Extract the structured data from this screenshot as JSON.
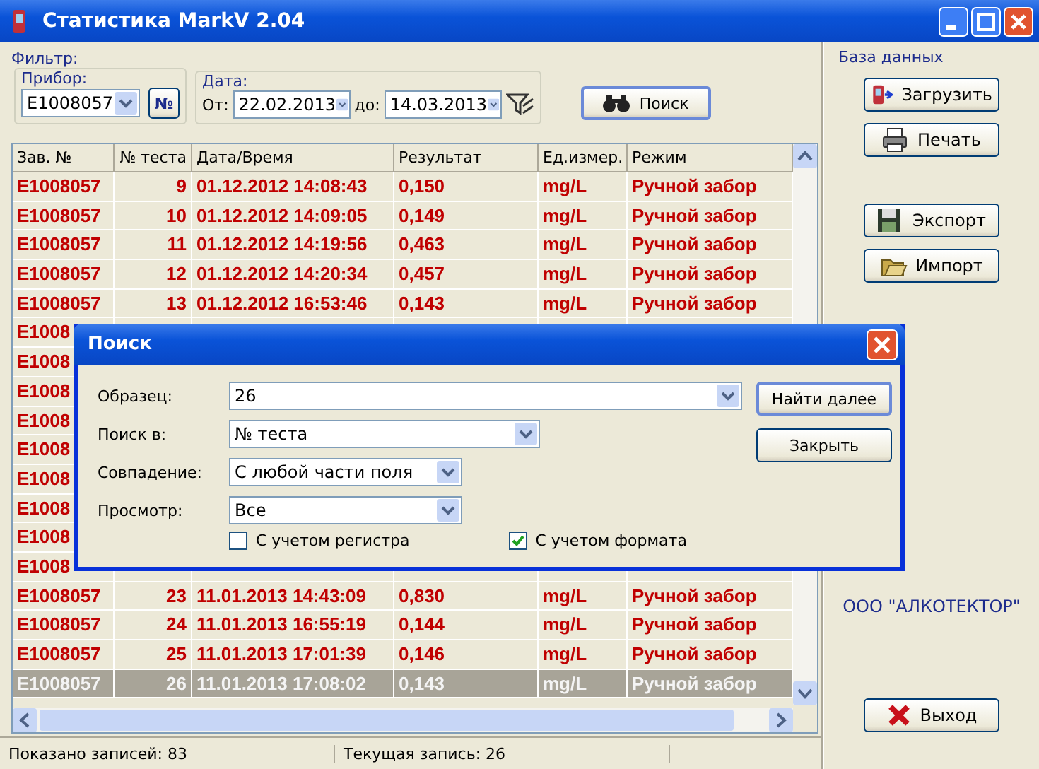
{
  "window": {
    "title": "Статистика MarkV 2.04"
  },
  "filter": {
    "title": "Фильтр:",
    "device_label": "Прибор:",
    "device": "E1008057",
    "number_button": "№",
    "date_label": "Дата:",
    "from_label": "От:",
    "from": "22.02.2013",
    "to_label": "до:",
    "to": "14.03.2013",
    "search_button": "Поиск"
  },
  "database": {
    "title": "База данных",
    "buttons": [
      {
        "label": "Загрузить",
        "kind": "load"
      },
      {
        "label": "Печать",
        "kind": "print"
      },
      {
        "label": "Экспорт",
        "kind": "export"
      },
      {
        "label": "Импорт",
        "kind": "import"
      }
    ],
    "company": "ООО \"АЛКОТЕКТОР\"",
    "exit_button": "Выход"
  },
  "table": {
    "columns": [
      "Зав. №",
      "№ теста",
      "Дата/Время",
      "Результат",
      "Ед.измер.",
      "Режим"
    ],
    "rows": [
      {
        "cells": [
          "E1008057",
          "9",
          "01.12.2012 14:08:43",
          "0,150",
          "mg/L",
          "Ручной забор"
        ],
        "selected": false
      },
      {
        "cells": [
          "E1008057",
          "10",
          "01.12.2012 14:09:05",
          "0,149",
          "mg/L",
          "Ручной забор"
        ],
        "selected": false
      },
      {
        "cells": [
          "E1008057",
          "11",
          "01.12.2012 14:19:56",
          "0,463",
          "mg/L",
          "Ручной забор"
        ],
        "selected": false
      },
      {
        "cells": [
          "E1008057",
          "12",
          "01.12.2012 14:20:34",
          "0,457",
          "mg/L",
          "Ручной забор"
        ],
        "selected": false
      },
      {
        "cells": [
          "E1008057",
          "13",
          "01.12.2012 16:53:46",
          "0,143",
          "mg/L",
          "Ручной забор"
        ],
        "selected": false
      },
      {
        "cells": [
          "E1008"
        ],
        "selected": false
      },
      {
        "cells": [
          "E1008"
        ],
        "selected": false
      },
      {
        "cells": [
          "E1008"
        ],
        "selected": false
      },
      {
        "cells": [
          "E1008"
        ],
        "selected": false
      },
      {
        "cells": [
          "E1008"
        ],
        "selected": false
      },
      {
        "cells": [
          "E1008"
        ],
        "selected": false
      },
      {
        "cells": [
          "E1008"
        ],
        "selected": false
      },
      {
        "cells": [
          "E1008"
        ],
        "selected": false
      },
      {
        "cells": [
          "E1008"
        ],
        "selected": false
      },
      {
        "cells": [
          "E1008057",
          "23",
          "11.01.2013 14:43:09",
          "0,830",
          "mg/L",
          "Ручной забор"
        ],
        "selected": false
      },
      {
        "cells": [
          "E1008057",
          "24",
          "11.01.2013 16:55:19",
          "0,144",
          "mg/L",
          "Ручной забор"
        ],
        "selected": false
      },
      {
        "cells": [
          "E1008057",
          "25",
          "11.01.2013 17:01:39",
          "0,146",
          "mg/L",
          "Ручной забор"
        ],
        "selected": false
      },
      {
        "cells": [
          "E1008057",
          "26",
          "11.01.2013 17:08:02",
          "0,143",
          "mg/L",
          "Ручной забор"
        ],
        "selected": true
      }
    ]
  },
  "status_bar": [
    "Показано записей: 83",
    "Текущая запись: 26"
  ],
  "dialog": {
    "title": "Поиск",
    "fields": [
      {
        "label": "Образец:",
        "value": "26"
      },
      {
        "label": "Поиск в:",
        "value": "№ теста"
      },
      {
        "label": "Совпадение:",
        "value": "С любой части поля"
      },
      {
        "label": "Просмотр:",
        "value": "Все"
      }
    ],
    "checkboxes": [
      {
        "label": "С учетом регистра",
        "checked": false
      },
      {
        "label": "С учетом формата",
        "checked": true
      }
    ],
    "buttons": [
      {
        "label": "Найти далее",
        "default": true
      },
      {
        "label": "Закрыть",
        "default": false
      }
    ]
  }
}
